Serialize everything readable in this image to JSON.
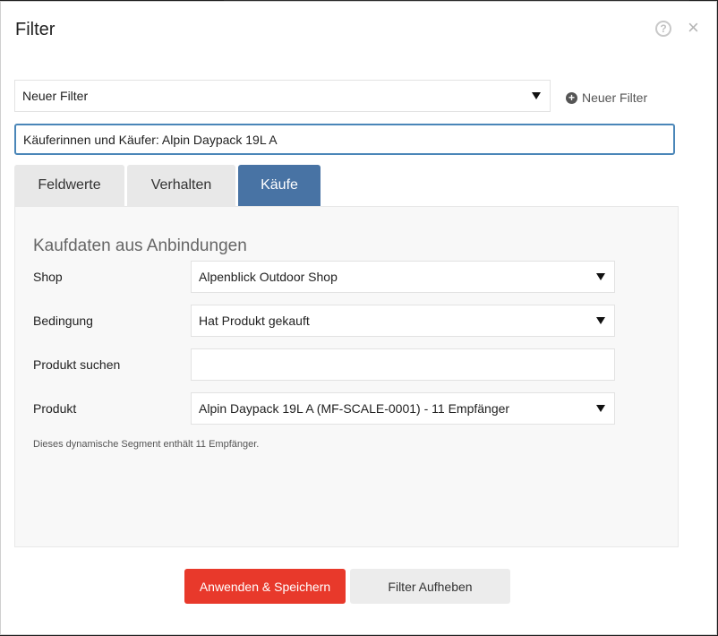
{
  "dialog": {
    "title": "Filter",
    "help_icon": "?",
    "close_icon": "×"
  },
  "filter_select": {
    "value": "Neuer Filter"
  },
  "new_filter_link": {
    "label": "Neuer Filter"
  },
  "filter_name": {
    "value": "Käuferinnen und Käufer: Alpin Daypack 19L A"
  },
  "tabs": [
    {
      "label": "Feldwerte",
      "active": false
    },
    {
      "label": "Verhalten",
      "active": false
    },
    {
      "label": "Käufe",
      "active": true
    }
  ],
  "panel": {
    "heading": "Kaufdaten aus Anbindungen",
    "fields": {
      "shop": {
        "label": "Shop",
        "value": "Alpenblick Outdoor Shop"
      },
      "condition": {
        "label": "Bedingung",
        "value": "Hat Produkt gekauft"
      },
      "search": {
        "label": "Produkt suchen",
        "value": ""
      },
      "product": {
        "label": "Produkt",
        "value": "Alpin Daypack 19L A (MF-SCALE-0001) - 11 Empfänger"
      }
    },
    "info": "Dieses dynamische Segment enthält 11 Empfänger."
  },
  "buttons": {
    "apply": "Anwenden & Speichern",
    "clear": "Filter Aufheben"
  },
  "colors": {
    "accent_tab": "#4873a4",
    "primary_button": "#e8392b",
    "input_focus": "#4a86b8"
  }
}
